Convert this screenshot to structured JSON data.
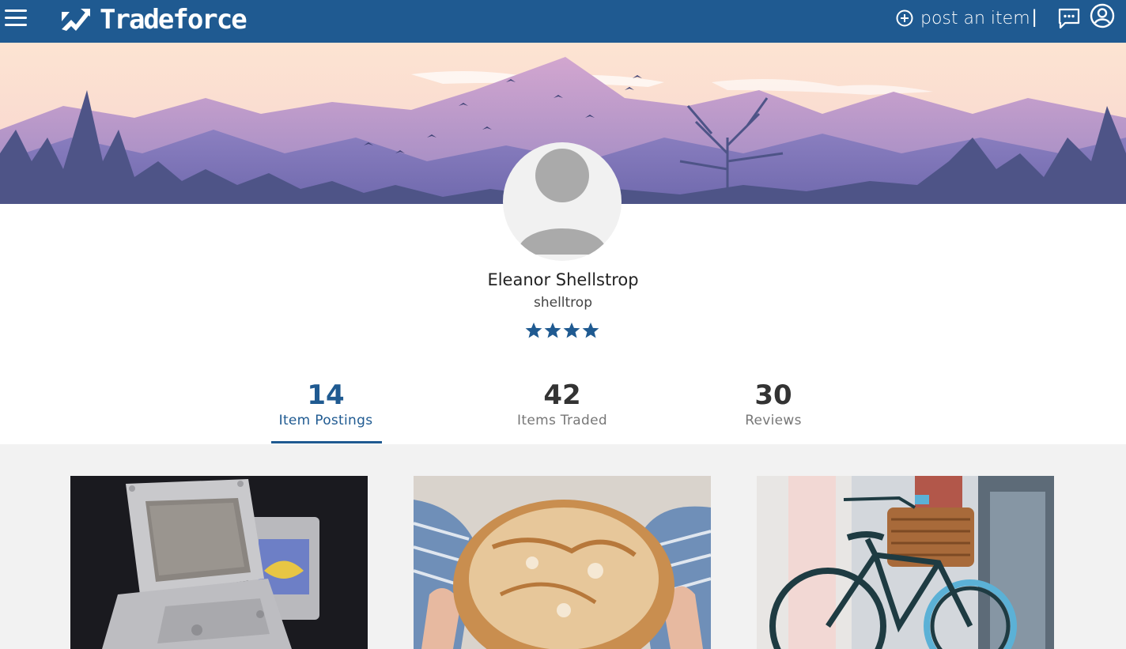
{
  "header": {
    "brand": "Tradeforce",
    "post_label": "post an item",
    "separator": "|"
  },
  "profile": {
    "name": "Eleanor Shellstrop",
    "username": "shelltrop",
    "rating_stars": 4
  },
  "stats": [
    {
      "value": "14",
      "label": "Item Postings",
      "active": true
    },
    {
      "value": "42",
      "label": "Items Traded",
      "active": false
    },
    {
      "value": "30",
      "label": "Reviews",
      "active": false
    }
  ],
  "items": [
    {
      "image": "game-boy-advance-sp-photo"
    },
    {
      "image": "bread-loaf-photo"
    },
    {
      "image": "bicycle-with-basket-photo"
    }
  ],
  "colors": {
    "brand_blue": "#1f5a91",
    "page_bg": "#f2f2f2"
  }
}
